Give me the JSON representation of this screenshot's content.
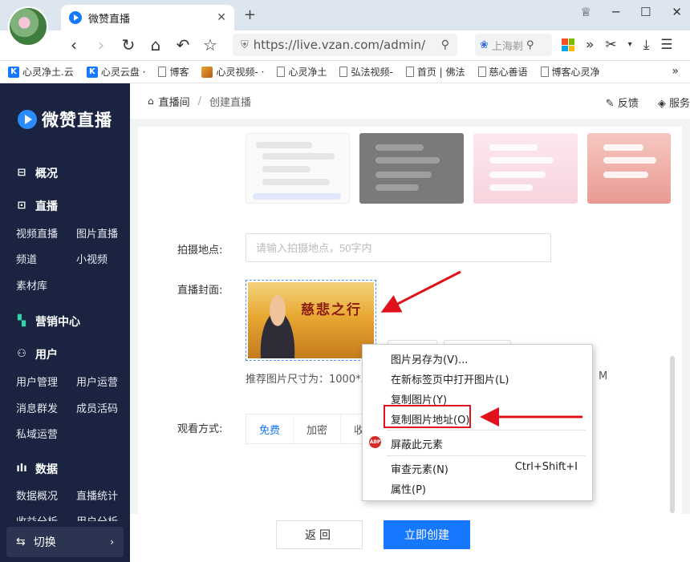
{
  "browser": {
    "tab_title": "微赞直播",
    "tab_close": "✕",
    "new_tab": "+",
    "url": "https://live.vzan.com/admin/",
    "search_placeholder": "上海剃",
    "bookmarks": [
      {
        "label": "心灵净土.云",
        "icon": "K"
      },
      {
        "label": "心灵云盘 ·",
        "icon": "K"
      },
      {
        "label": "博客",
        "icon": "doc"
      },
      {
        "label": "心灵视频- ·",
        "icon": "img"
      },
      {
        "label": "心灵净土",
        "icon": "doc"
      },
      {
        "label": "弘法视频-",
        "icon": "doc"
      },
      {
        "label": "首页 | 佛法",
        "icon": "doc"
      },
      {
        "label": "慈心善语",
        "icon": "doc"
      },
      {
        "label": "博客心灵净",
        "icon": "doc"
      }
    ],
    "bookmarks_more": "»"
  },
  "sidebar": {
    "brand": "微赞直播",
    "overview": "概况",
    "live": "直播",
    "live_items": [
      "视频直播",
      "图片直播",
      "频道",
      "小视频",
      "素材库"
    ],
    "marketing": "营销中心",
    "user": "用户",
    "user_items": [
      "用户管理",
      "用户运营",
      "消息群发",
      "成员活码",
      "私域运营"
    ],
    "data": "数据",
    "data_items": [
      "数据概况",
      "直播统计",
      "收益分析",
      "用户分析"
    ],
    "switch": "切换",
    "switch_arrow": "›"
  },
  "main": {
    "crumb_home": "直播间",
    "crumb_sep": "/",
    "crumb_current": "创建直播",
    "feedback": "反馈",
    "service": "服务",
    "location_label": "拍摄地点:",
    "location_placeholder": "请输入拍摄地点，50字内",
    "cover_label": "直播封面:",
    "cover_title": "慈悲之行",
    "hint": "推荐图片尺寸为：1000*56",
    "hint_tail": "M",
    "watch_label": "观看方式:",
    "watch_tabs": [
      "免费",
      "加密",
      "收"
    ],
    "back_btn": "返回",
    "create_btn": "立即创建"
  },
  "context_menu": {
    "items": [
      "图片另存为(V)...",
      "在新标签页中打开图片(L)",
      "复制图片(Y)",
      "复制图片地址(O)",
      "屏蔽此元素",
      "审查元素(N)",
      "属性(P)"
    ],
    "shortcut_inspect": "Ctrl+Shift+I",
    "abp_badge": "ABP"
  },
  "colors": {
    "sidebar_bg": "#1a2440",
    "accent": "#1677ff",
    "annotation": "#e0111c"
  }
}
